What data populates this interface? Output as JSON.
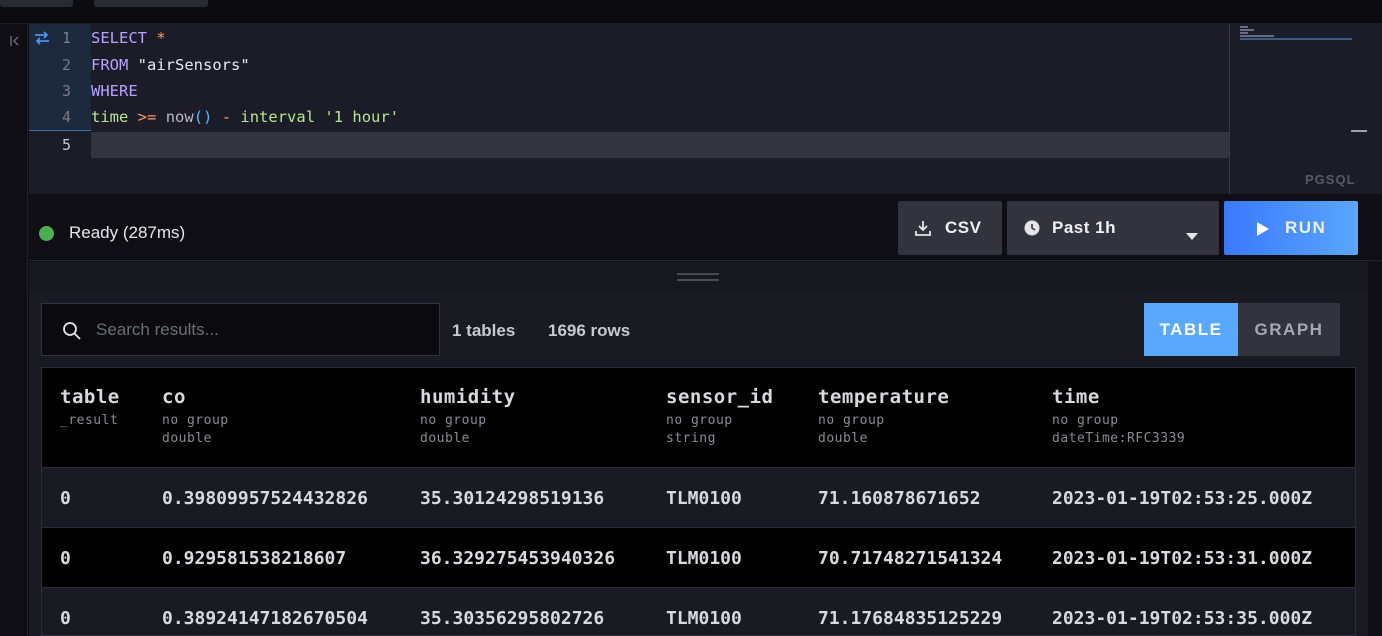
{
  "editor": {
    "line_numbers": [
      "1",
      "2",
      "3",
      "4",
      "5"
    ],
    "lines": {
      "l1_kw": "SELECT",
      "l1_star": "*",
      "l2_kw": "FROM",
      "l2_str": "\"airSensors\"",
      "l3_kw": "WHERE",
      "l4_id": "time",
      "l4_op": ">=",
      "l4_fn": "now",
      "l4_par": "()",
      "l4_minus": "-",
      "l4_kw": "interval",
      "l4_sq": "'1 hour'"
    },
    "language": "PGSQL"
  },
  "toolbar": {
    "status": "Ready (287ms)",
    "status_color": "#4caf50",
    "csv_label": "CSV",
    "time_range": "Past 1h",
    "run_label": "RUN"
  },
  "results": {
    "search_placeholder": "Search results...",
    "tables_count": "1 tables",
    "rows_count": "1696 rows",
    "view_table": "TABLE",
    "view_graph": "GRAPH",
    "columns": [
      {
        "name": "table",
        "sub1": "_result",
        "sub2": ""
      },
      {
        "name": "co",
        "sub1": "no group",
        "sub2": "double"
      },
      {
        "name": "humidity",
        "sub1": "no group",
        "sub2": "double"
      },
      {
        "name": "sensor_id",
        "sub1": "no group",
        "sub2": "string"
      },
      {
        "name": "temperature",
        "sub1": "no group",
        "sub2": "double"
      },
      {
        "name": "time",
        "sub1": "no group",
        "sub2": "dateTime:RFC3339"
      }
    ],
    "rows": [
      [
        "0",
        "0.39809957524432826",
        "35.30124298519136",
        "TLM0100",
        "71.160878671652",
        "2023-01-19T02:53:25.000Z"
      ],
      [
        "0",
        "0.929581538218607",
        "36.329275453940326",
        "TLM0100",
        "70.71748271541324",
        "2023-01-19T02:53:31.000Z"
      ],
      [
        "0",
        "0.38924147182670504",
        "35.30356295802726",
        "TLM0100",
        "71.17684835125229",
        "2023-01-19T02:53:35.000Z"
      ]
    ]
  },
  "icons": {
    "collapse": "collapse-left-icon",
    "wrap": "word-wrap-icon",
    "download": "download-icon",
    "clock": "clock-icon",
    "caret": "caret-down-icon",
    "play": "play-icon",
    "search": "search-icon"
  }
}
